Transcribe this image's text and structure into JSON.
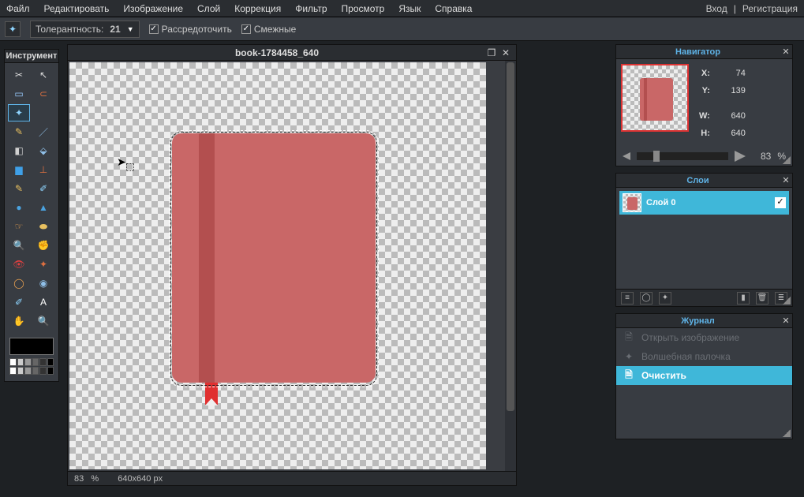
{
  "menu": {
    "items": [
      "Файл",
      "Редактировать",
      "Изображение",
      "Слой",
      "Коррекция",
      "Фильтр",
      "Просмотр",
      "Язык",
      "Справка"
    ],
    "login": "Вход",
    "sep": "|",
    "register": "Регистрация"
  },
  "options": {
    "tool_icon": "✦",
    "tolerance_label": "Толерантность:",
    "tolerance_value": "21",
    "anti_alias": "Рассредоточить",
    "contiguous": "Смежные"
  },
  "toolpanel": {
    "title": "Инструмент",
    "tools": [
      {
        "name": "crop-tool",
        "glyph": "✂",
        "c": "#ddd"
      },
      {
        "name": "move-tool",
        "glyph": "↖",
        "c": "#ddd"
      },
      {
        "name": "marquee-tool",
        "glyph": "▭",
        "c": "#9cf"
      },
      {
        "name": "lasso-tool",
        "glyph": "⊂",
        "c": "#e07040"
      },
      {
        "name": "wand-tool",
        "glyph": "✦",
        "c": "#8fd5ff",
        "sel": true
      },
      {
        "name": "empty-1",
        "glyph": "",
        "c": ""
      },
      {
        "name": "pencil-tool",
        "glyph": "✎",
        "c": "#e8c060"
      },
      {
        "name": "brush-tool",
        "glyph": "／",
        "c": "#8fbfe8"
      },
      {
        "name": "eraser-tool",
        "glyph": "◧",
        "c": "#d0d0d0"
      },
      {
        "name": "bucket-tool",
        "glyph": "⬙",
        "c": "#8fbfe8"
      },
      {
        "name": "gradient-tool",
        "glyph": "▆",
        "c": "#3fa0e8"
      },
      {
        "name": "stamp-tool",
        "glyph": "⊥",
        "c": "#e07040"
      },
      {
        "name": "replace-color",
        "glyph": "✎",
        "c": "#e8c060"
      },
      {
        "name": "draw-tool",
        "glyph": "✐",
        "c": "#8fd5ff"
      },
      {
        "name": "blur-tool",
        "glyph": "●",
        "c": "#4aa3e0"
      },
      {
        "name": "sharpen-tool",
        "glyph": "▲",
        "c": "#4aa3e0"
      },
      {
        "name": "smudge-tool",
        "glyph": "☞",
        "c": "#e8a050"
      },
      {
        "name": "sponge-tool",
        "glyph": "⬬",
        "c": "#e8c060"
      },
      {
        "name": "dodge-tool",
        "glyph": "🔍",
        "c": "#ddd"
      },
      {
        "name": "burn-tool",
        "glyph": "✊",
        "c": "#e8a050"
      },
      {
        "name": "redeye-tool",
        "glyph": "👁",
        "c": "#e04040"
      },
      {
        "name": "heal-tool",
        "glyph": "✦",
        "c": "#e07040"
      },
      {
        "name": "bloat-tool",
        "glyph": "◯",
        "c": "#e8a050"
      },
      {
        "name": "pinch-tool",
        "glyph": "◉",
        "c": "#8fbfe8"
      },
      {
        "name": "picker-tool",
        "glyph": "✐",
        "c": "#8fd5ff"
      },
      {
        "name": "type-tool",
        "glyph": "A",
        "c": "#fff"
      },
      {
        "name": "hand-tool",
        "glyph": "✋",
        "c": "#e8a050"
      },
      {
        "name": "zoom-tool",
        "glyph": "🔍",
        "c": "#ddd"
      }
    ],
    "palette": [
      "#fff",
      "#ccc",
      "#999",
      "#666",
      "#333",
      "#000",
      "#fff",
      "#ccc",
      "#999",
      "#666",
      "#333",
      "#000"
    ]
  },
  "document": {
    "title": "book-1784458_640",
    "zoom": "83",
    "pct": "%",
    "dims": "640x640 px"
  },
  "navigator": {
    "title": "Навигатор",
    "X_k": "X:",
    "X_v": "74",
    "Y_k": "Y:",
    "Y_v": "139",
    "W_k": "W:",
    "W_v": "640",
    "H_k": "H:",
    "H_v": "640",
    "zoom": "83",
    "pct": "%"
  },
  "layers": {
    "title": "Слои",
    "layer0": "Слой 0"
  },
  "history": {
    "title": "Журнал",
    "items": [
      {
        "icon": "🗎",
        "label": "Открыть изображение",
        "disabled": true
      },
      {
        "icon": "✦",
        "label": "Волшебная палочка",
        "disabled": true
      },
      {
        "icon": "🗎",
        "label": "Очистить",
        "selected": true
      }
    ]
  }
}
